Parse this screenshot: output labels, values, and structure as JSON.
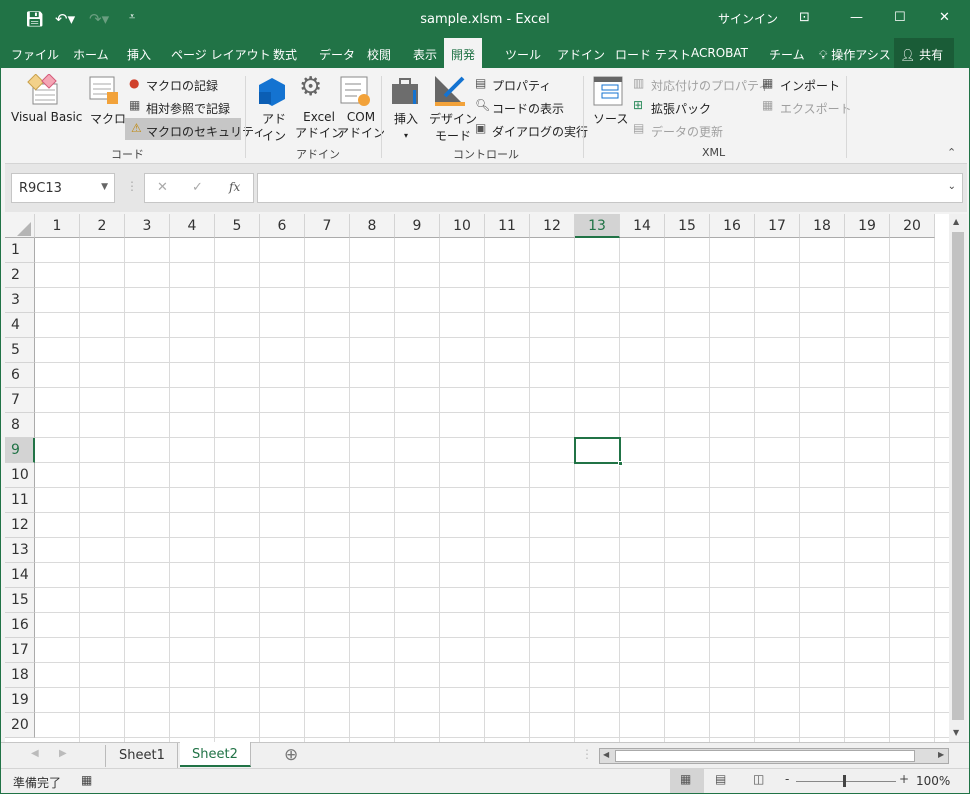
{
  "title": "sample.xlsm  -  Excel",
  "titlebar": {
    "signin": "サインイン"
  },
  "tabs": [
    "ファイル",
    "ホーム",
    "挿入",
    "ページ レイアウト",
    "数式",
    "データ",
    "校閲",
    "表示",
    "開発",
    "ツール",
    "アドイン",
    "ロード テスト",
    "ACROBAT",
    "チーム"
  ],
  "active_tab": "開発",
  "tell_me": "操作アシス",
  "share": "共有",
  "ribbon": {
    "code": {
      "label": "コード",
      "visual_basic": "Visual Basic",
      "macro": "マクロ",
      "record": "マクロの記録",
      "relative": "相対参照で記録",
      "security": "マクロのセキュリティ"
    },
    "addins": {
      "label": "アドイン",
      "addin_1": "アド",
      "addin_2": "イン",
      "excel_1": "Excel",
      "excel_2": "アドイン",
      "com_1": "COM",
      "com_2": "アドイン"
    },
    "controls": {
      "label": "コントロール",
      "insert": "挿入",
      "design_1": "デザイン",
      "design_2": "モード",
      "properties": "プロパティ",
      "view_code": "コードの表示",
      "run_dialog": "ダイアログの実行"
    },
    "xml": {
      "label": "XML",
      "source": "ソース",
      "map_props": "対応付けのプロパティ",
      "expansion": "拡張パック",
      "refresh": "データの更新",
      "import": "インポート",
      "export": "エクスポート"
    }
  },
  "formula": {
    "name_box": "R9C13",
    "fx": "fx",
    "value": ""
  },
  "columns": [
    "1",
    "2",
    "3",
    "4",
    "5",
    "6",
    "7",
    "8",
    "9",
    "10",
    "11",
    "12",
    "13",
    "14",
    "15",
    "16",
    "17",
    "18",
    "19",
    "20"
  ],
  "rows": [
    "1",
    "2",
    "3",
    "4",
    "5",
    "6",
    "7",
    "8",
    "9",
    "10",
    "11",
    "12",
    "13",
    "14",
    "15",
    "16",
    "17",
    "18",
    "19",
    "20"
  ],
  "selected": {
    "row": "9",
    "col": "13"
  },
  "sheets": [
    "Sheet1",
    "Sheet2"
  ],
  "active_sheet": "Sheet2",
  "status": {
    "ready": "準備完了",
    "zoom": "100%",
    "zoom_level": 100
  },
  "colors": {
    "accent": "#217346"
  }
}
